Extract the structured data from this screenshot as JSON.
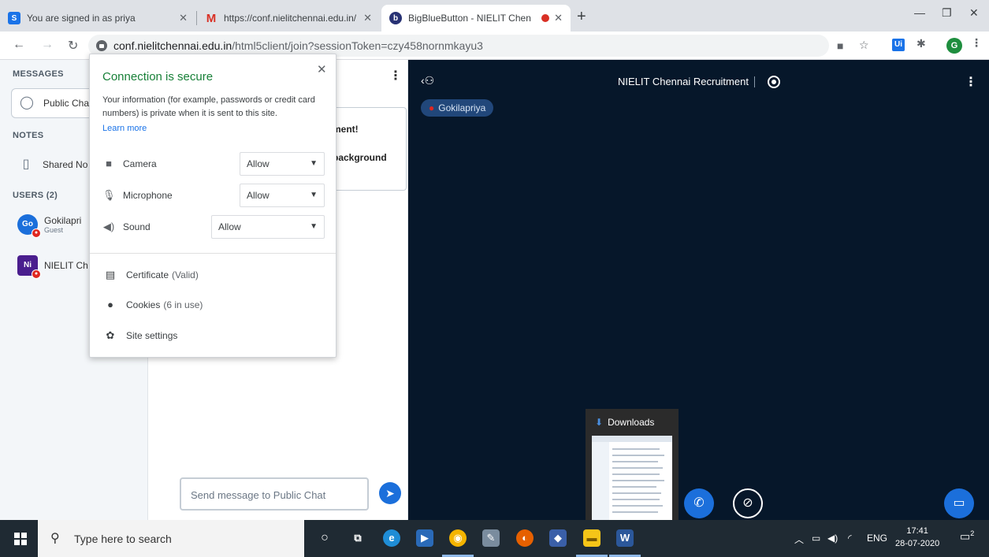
{
  "browser": {
    "tabs": [
      {
        "title": "You are signed in as priya",
        "icon": "s-favicon",
        "color": "#1a73e8"
      },
      {
        "title": "https://conf.nielitchennai.edu.in/",
        "icon": "gmail-icon",
        "color": "#d93025"
      },
      {
        "title": "BigBlueButton - NIELIT Chen",
        "icon": "bigbluebutton-icon",
        "color": "#283274",
        "active": true,
        "recording": true
      }
    ],
    "url_host": "conf.nielitchennai.edu.in",
    "url_path": "/html5client/join?sessionToken=czy458nornmkayu3",
    "extension_badge": "Ui",
    "profile_initial": "G"
  },
  "sidebar": {
    "messages_title": "MESSAGES",
    "public_chat": "Public Cha",
    "notes_title": "NOTES",
    "shared_notes": "Shared No",
    "users_title": "USERS (2)",
    "users": [
      {
        "initials": "Go",
        "name": "Gokilapri",
        "role": "Guest",
        "color": "#1b6fdb"
      },
      {
        "initials": "Ni",
        "name": "NIELIT Ch",
        "role": "",
        "color": "#4a1e8e"
      }
    ]
  },
  "chat": {
    "welcome_line1": "ment!",
    "welcome_line2": "background",
    "input_placeholder": "Send message to Public Chat"
  },
  "stage": {
    "title": "NIELIT Chennai Recruitment",
    "talker": "Gokilapriya"
  },
  "popup": {
    "title": "Connection is secure",
    "desc": "Your information (for example, passwords or credit card numbers) is private when it is sent to this site.",
    "learn_more": "Learn more",
    "permissions": [
      {
        "label": "Camera",
        "value": "Allow",
        "icon": "camera-icon"
      },
      {
        "label": "Microphone",
        "value": "Allow",
        "icon": "microphone-icon"
      },
      {
        "label": "Sound",
        "value": "Allow",
        "icon": "sound-icon"
      }
    ],
    "certificate": "Certificate",
    "certificate_status": "(Valid)",
    "cookies": "Cookies",
    "cookies_status": "(6 in use)",
    "site_settings": "Site settings"
  },
  "downloads": {
    "title": "Downloads"
  },
  "taskbar": {
    "search_placeholder": "Type here to search",
    "language": "ENG",
    "time": "17:41",
    "date": "28-07-2020",
    "notification_count": "2"
  },
  "colors": {
    "accent": "#1b6fdb",
    "stage_bg": "#06172a",
    "secure_green": "#188038"
  }
}
